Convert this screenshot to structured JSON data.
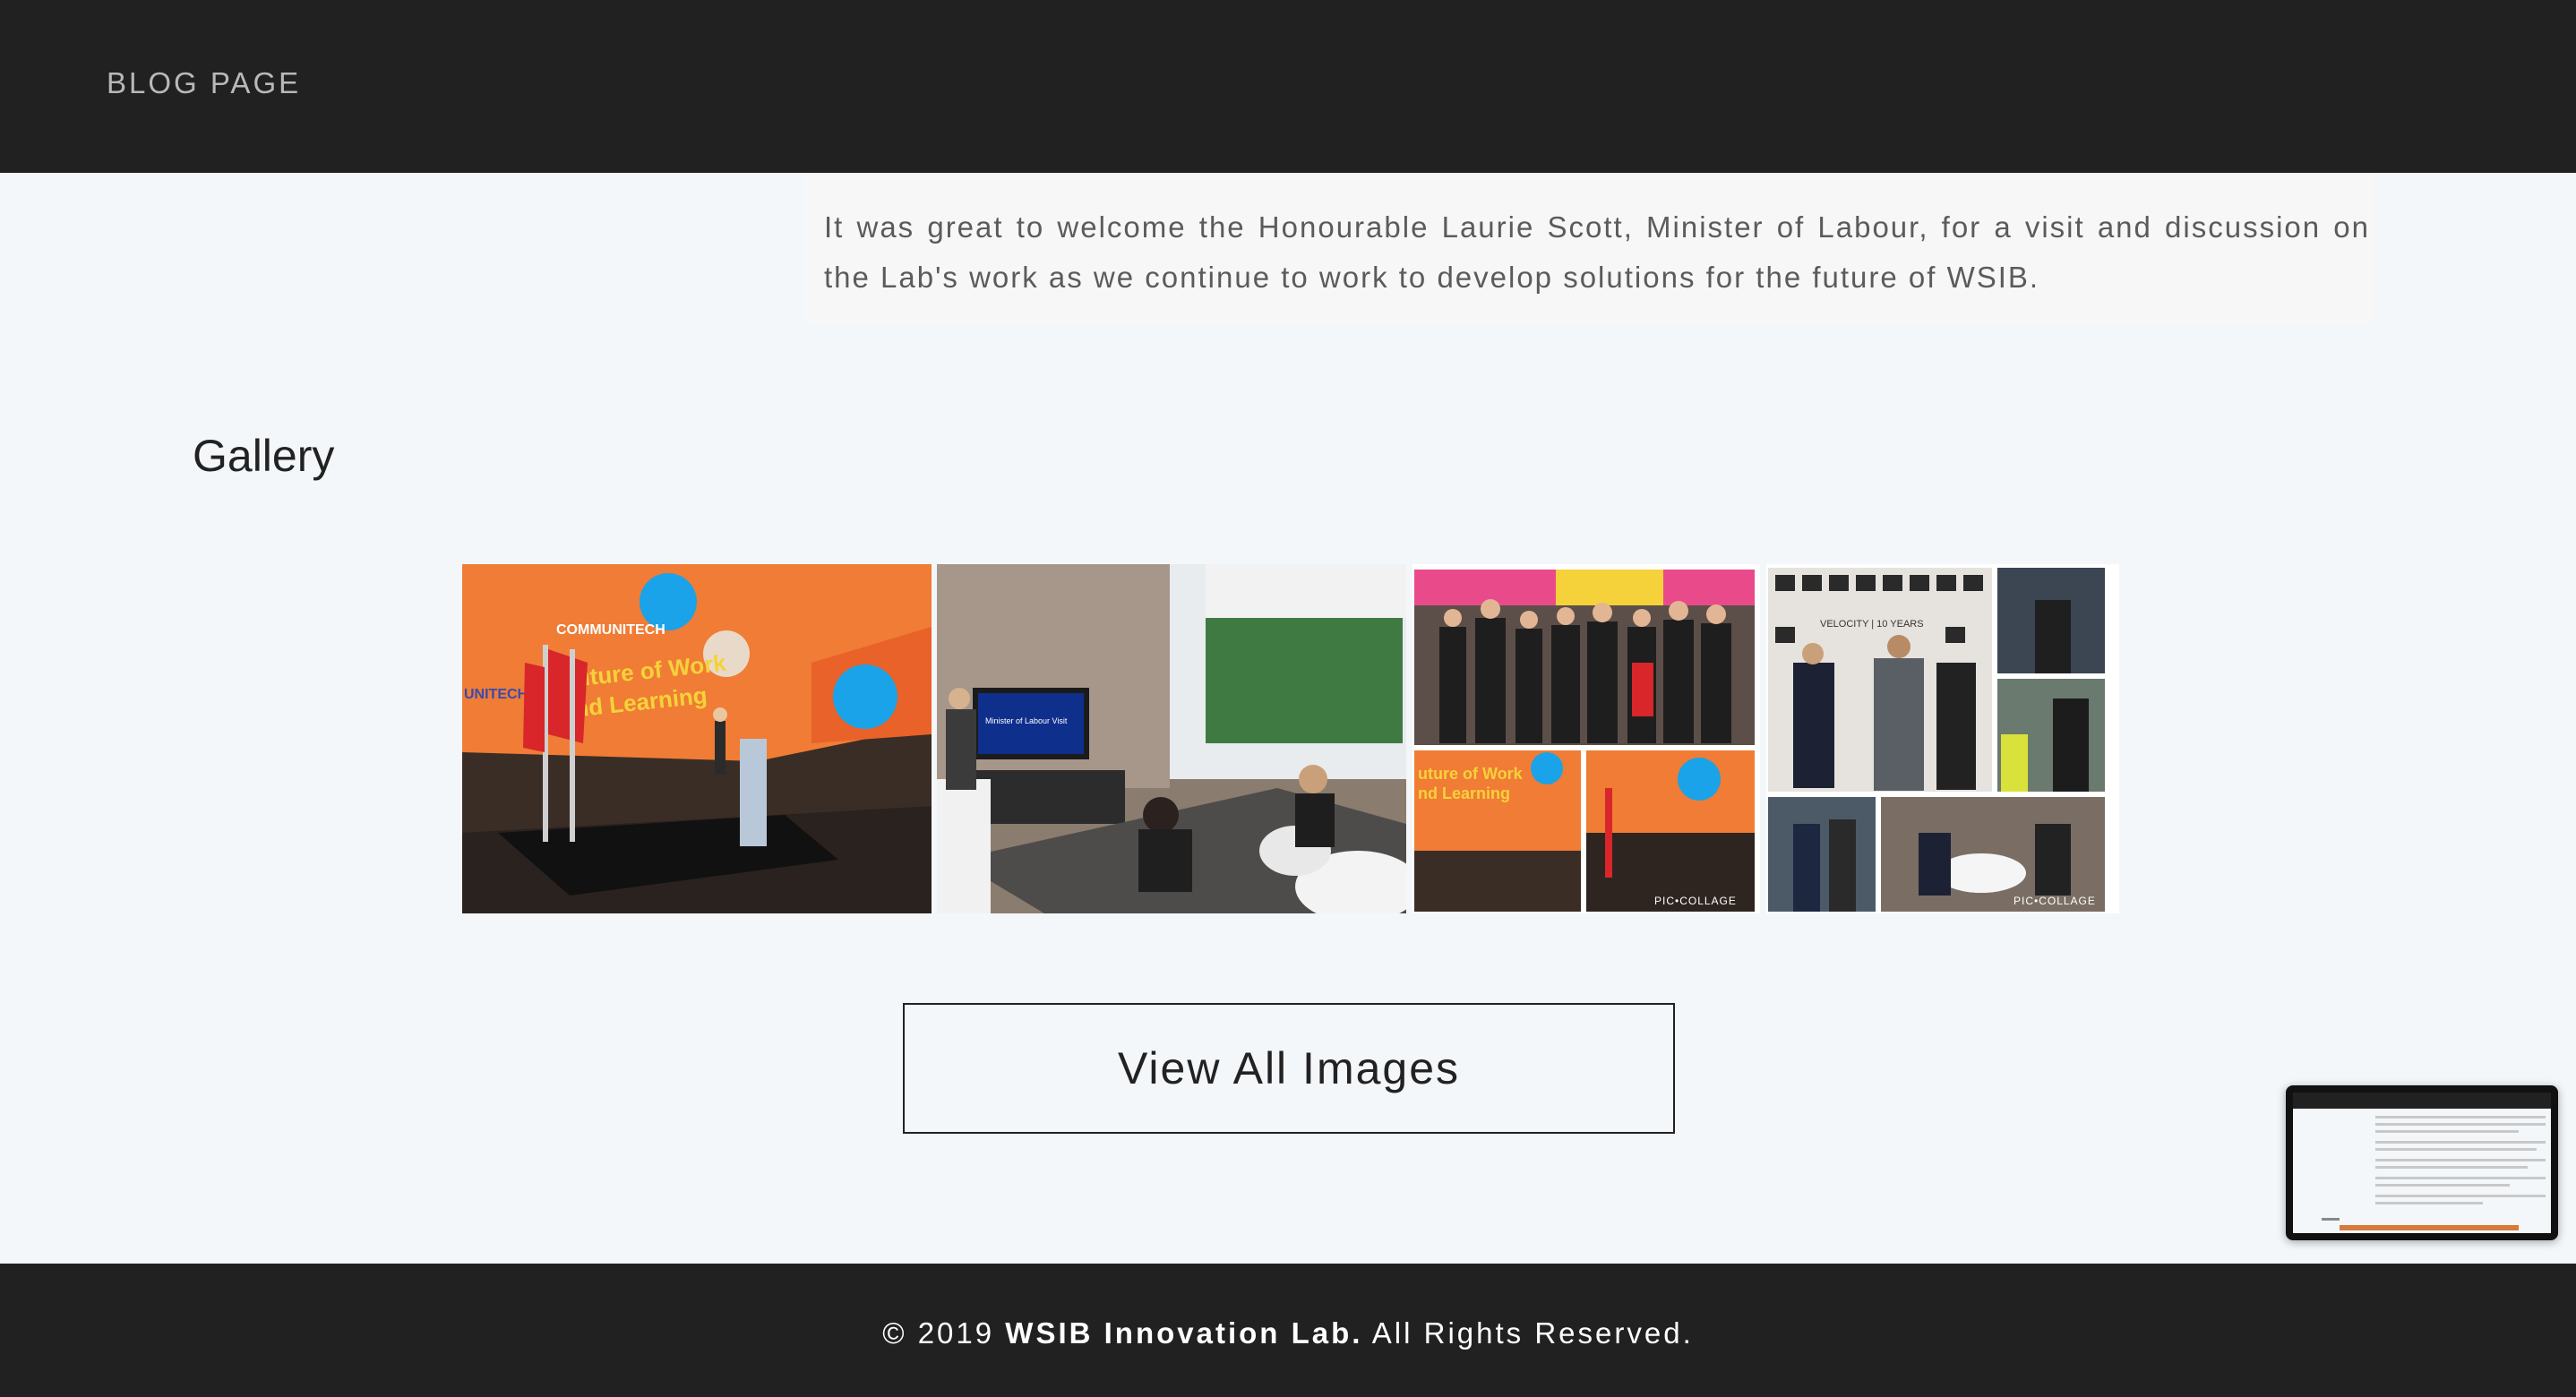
{
  "header": {
    "brand": "BLOG PAGE"
  },
  "intro": {
    "text": "It was great to welcome the Honourable Laurie Scott, Minister of Labour, for a visit and discussion on the Lab's work as we continue to work to develop solutions for the future of WSIB."
  },
  "gallery": {
    "title": "Gallery",
    "photos": [
      {
        "slide_line1": "COMMUNITECH",
        "slide_line2": "Future of Work",
        "slide_line3": "and Learning",
        "side_text": "UNITECH"
      },
      {
        "screen_text": "Minister of Labour Visit"
      },
      {
        "watermark": "PIC•COLLAGE"
      },
      {
        "watermark": "PIC•COLLAGE",
        "wall_text": "VELOCITY | 10 YEARS"
      }
    ],
    "view_all_label": "View All Images"
  },
  "footer": {
    "copyright_prefix": "© 2019 ",
    "org": "WSIB Innovation Lab.",
    "suffix": " All Rights Reserved."
  },
  "colors": {
    "header_bg": "#212121",
    "page_bg": "#f4f7fa",
    "slide_orange": "#f07c35",
    "slide_yellow": "#f5d23a",
    "accent_blue": "#1aa3e8"
  }
}
